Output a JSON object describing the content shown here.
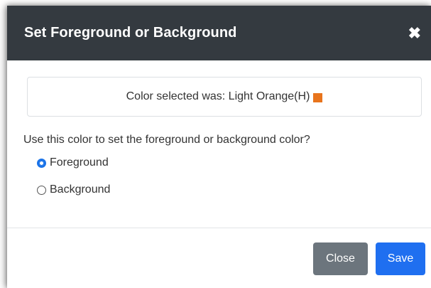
{
  "dialog": {
    "title": "Set Foreground or Background",
    "close_icon": "close-icon",
    "close_glyph": "✖"
  },
  "selection": {
    "prefix": "Color selected was: Light Orange(H)",
    "swatch_color": "#e8741c"
  },
  "question": "Use this color to set the foreground or background color?",
  "options": [
    {
      "label": "Foreground",
      "checked": true
    },
    {
      "label": "Background",
      "checked": false
    }
  ],
  "footer": {
    "close_label": "Close",
    "save_label": "Save"
  },
  "colors": {
    "header_bg": "#343a40",
    "primary": "#1f6ff0",
    "secondary": "#6c757d"
  }
}
